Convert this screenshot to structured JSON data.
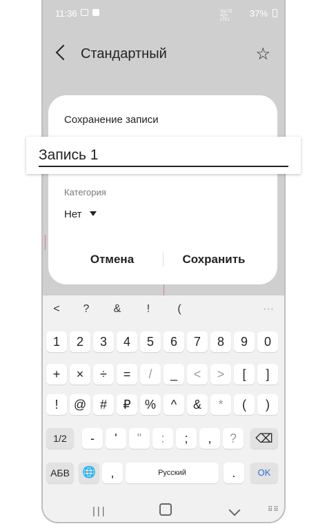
{
  "status": {
    "time": "11:36",
    "net": "VoLTE 4G+ LTE1",
    "battery": "37%"
  },
  "app": {
    "title": "Стандартный"
  },
  "dialog": {
    "title": "Сохранение записи",
    "name_value": "Запись 1",
    "category_label": "Категория",
    "category_value": "Нет",
    "cancel_label": "Отмена",
    "save_label": "Сохранить"
  },
  "keyboard": {
    "toolbar": [
      "<",
      "?",
      "&",
      "!",
      "(",
      "···"
    ],
    "row1": [
      "1",
      "2",
      "3",
      "4",
      "5",
      "6",
      "7",
      "8",
      "9",
      "0"
    ],
    "row2": [
      "+",
      "×",
      "÷",
      "=",
      "/",
      "_",
      "<",
      ">",
      "[",
      "]"
    ],
    "row3": [
      "!",
      "@",
      "#",
      "₽",
      "%",
      "^",
      "&",
      "*",
      "(",
      ")"
    ],
    "row4": [
      "1/2",
      "-",
      "'",
      "\"",
      ":",
      ";",
      ",",
      "?",
      "⌫"
    ],
    "row5": {
      "lang": "АБВ",
      "globe": "🌐",
      "comma": ",",
      "space": "Русский",
      "period": ".",
      "ok": "OK"
    }
  }
}
